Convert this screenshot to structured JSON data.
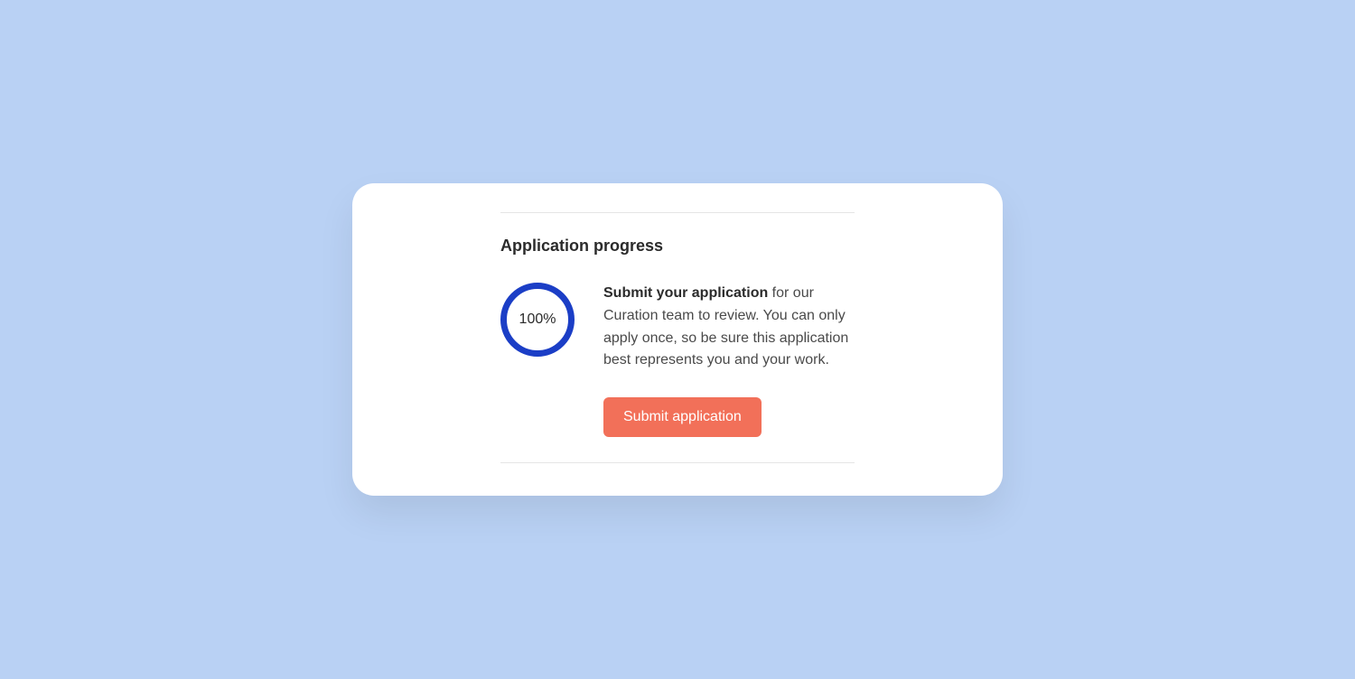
{
  "progress": {
    "title": "Application progress",
    "percent_label": "100%",
    "percent_value": 100,
    "description_bold": "Submit your application",
    "description_rest": " for our Curation team to review. You can only apply once, so be sure this application best represents you and your work.",
    "submit_label": "Submit application"
  }
}
